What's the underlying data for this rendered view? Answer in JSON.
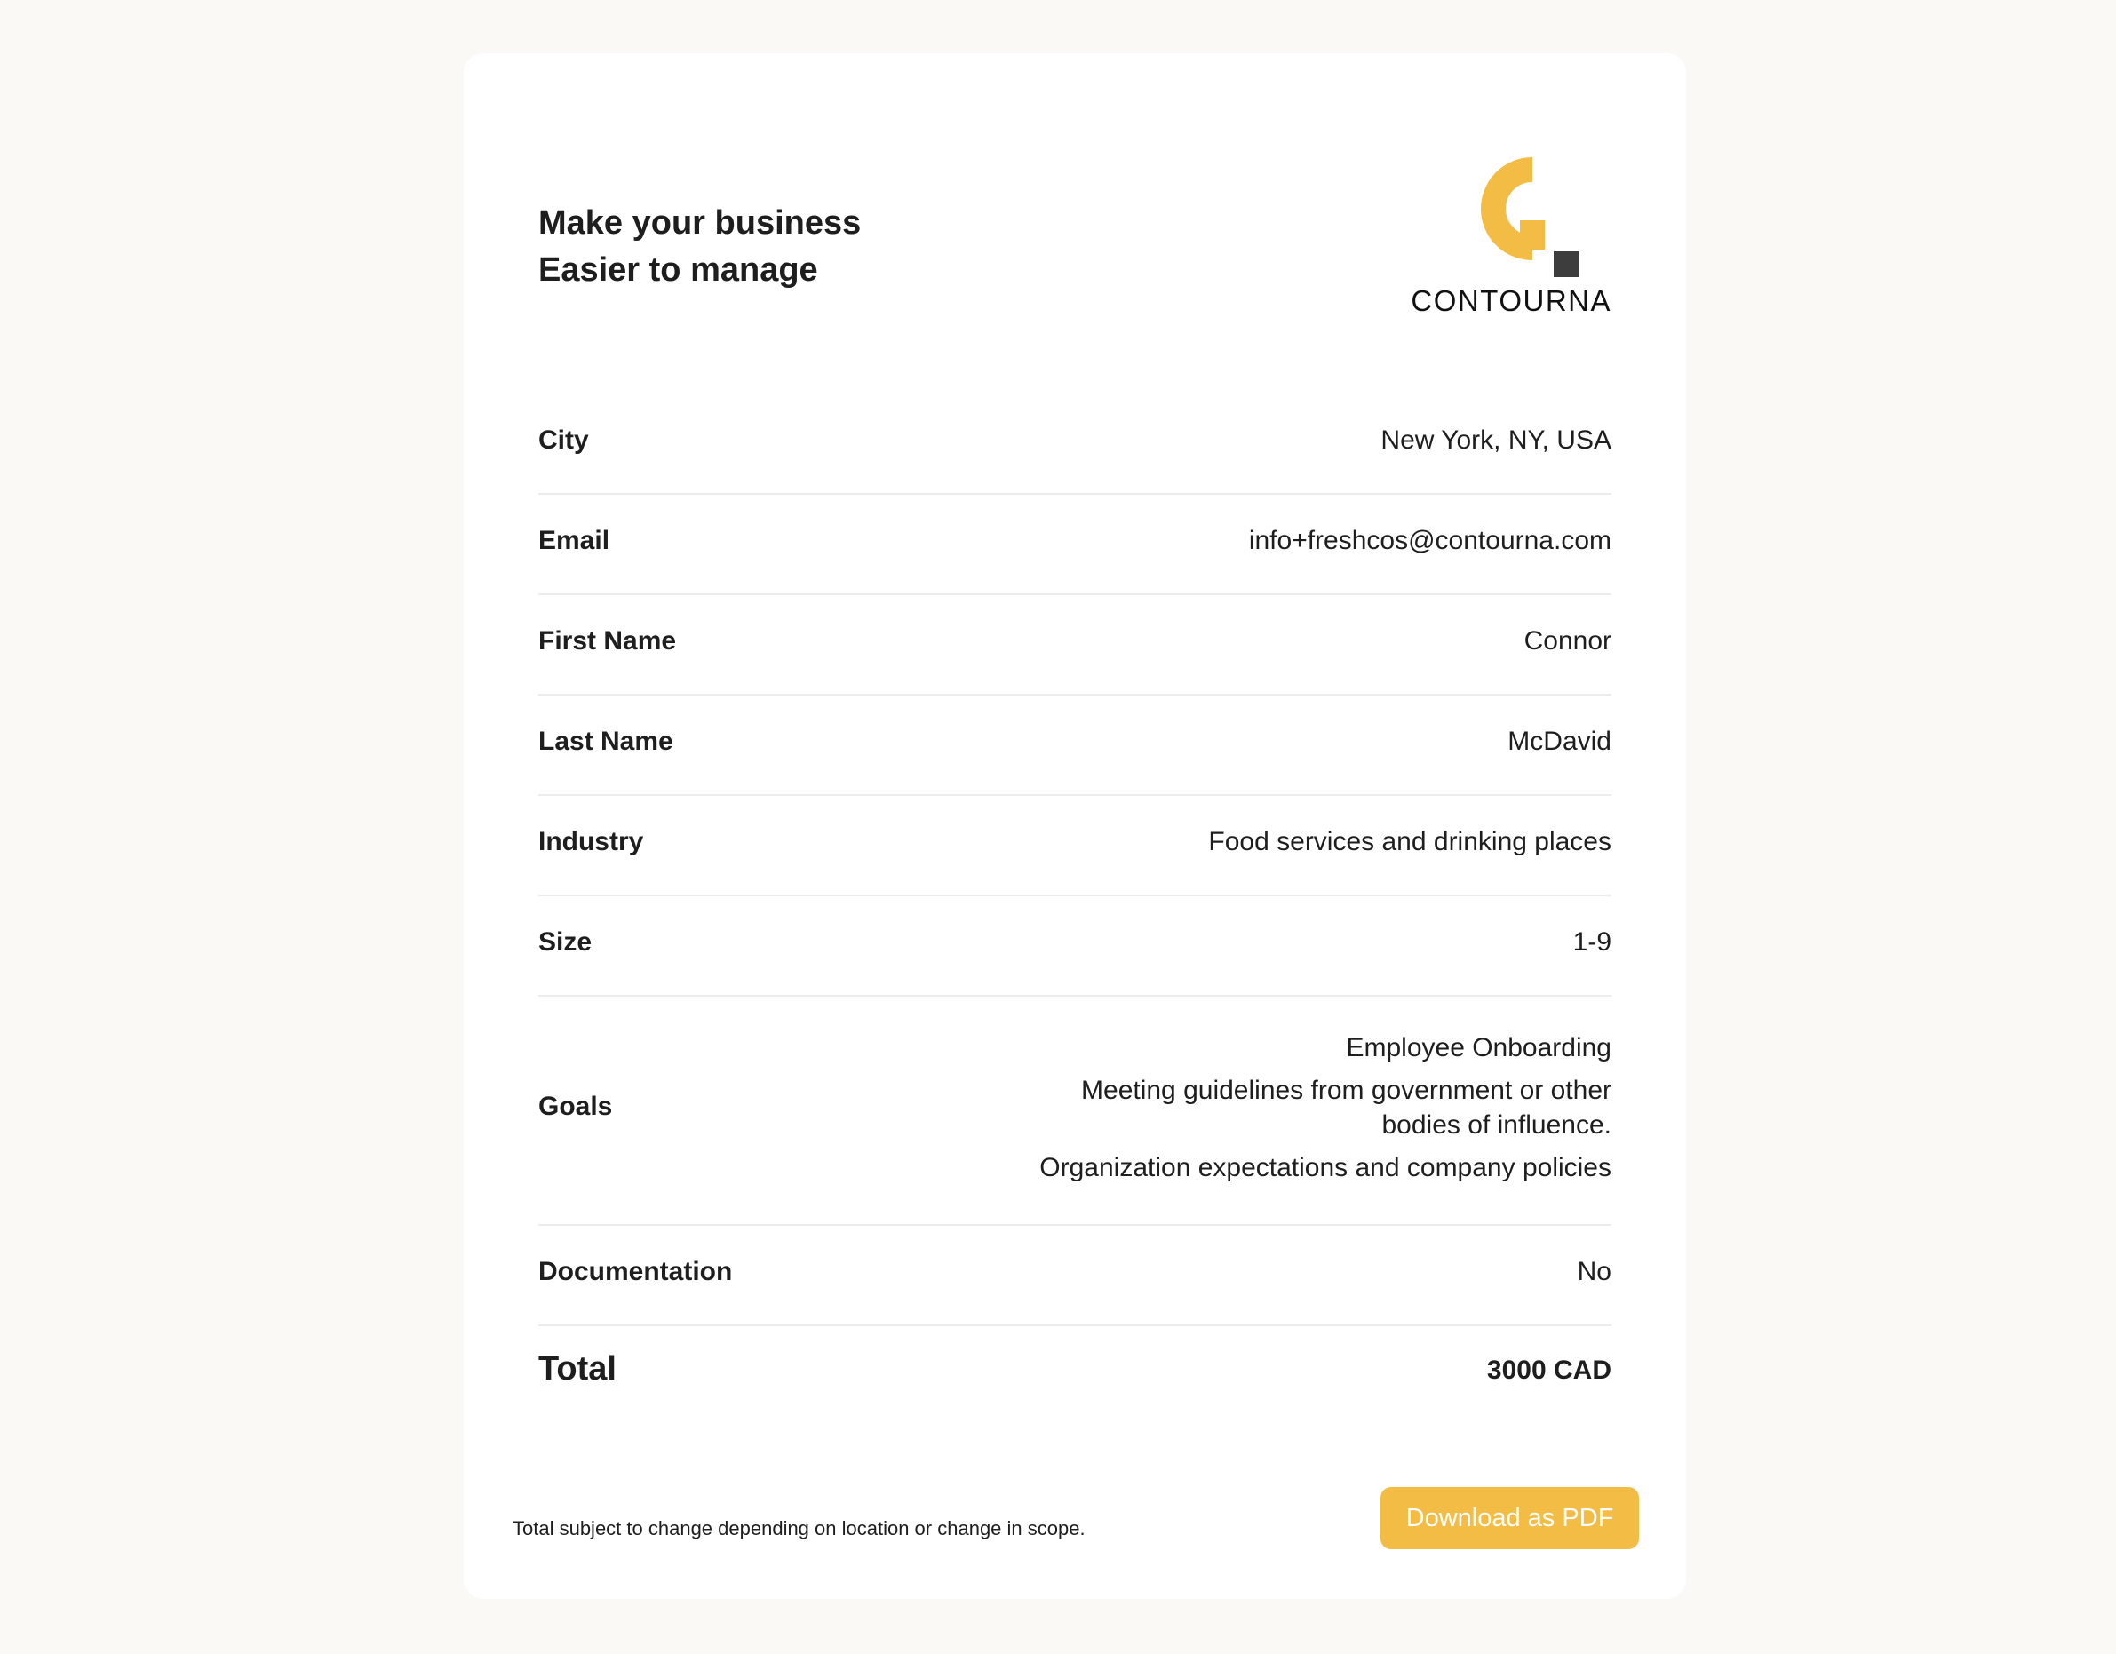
{
  "header": {
    "headline_line1": "Make your business",
    "headline_line2": "Easier to manage",
    "logo": {
      "icon": "contourna-logo-icon",
      "word": "CONTOURNA",
      "accent_color": "#f2bc45",
      "square_color": "#3d3d3d"
    }
  },
  "rows": [
    {
      "label": "City",
      "value": "New York, NY, USA"
    },
    {
      "label": "Email",
      "value": "info+freshcos@contourna.com"
    },
    {
      "label": "First Name",
      "value": "Connor"
    },
    {
      "label": "Last Name",
      "value": "McDavid"
    },
    {
      "label": "Industry",
      "value": "Food services and drinking places"
    },
    {
      "label": "Size",
      "value": "1-9"
    },
    {
      "label": "Goals",
      "values": [
        "Employee Onboarding",
        "Meeting guidelines from government or other bodies of influence.",
        "Organization expectations and company policies"
      ]
    },
    {
      "label": "Documentation",
      "value": "No"
    }
  ],
  "total": {
    "label": "Total",
    "value": "3000 CAD"
  },
  "footer": {
    "note": "Total subject to change depending on location or change in scope.",
    "download_label": "Download as PDF",
    "button_color": "#f2bc45"
  }
}
